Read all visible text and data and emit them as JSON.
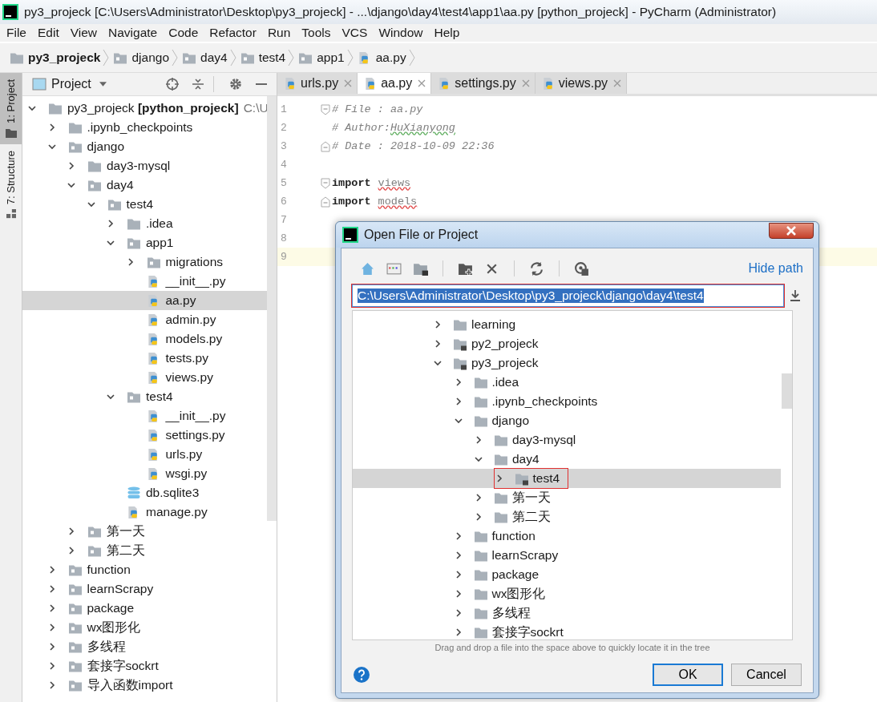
{
  "window": {
    "title": "py3_projeck [C:\\Users\\Administrator\\Desktop\\py3_projeck] - ...\\django\\day4\\test4\\app1\\aa.py [python_projeck] - PyCharm (Administrator)"
  },
  "menu": [
    "File",
    "Edit",
    "View",
    "Navigate",
    "Code",
    "Refactor",
    "Run",
    "Tools",
    "VCS",
    "Window",
    "Help"
  ],
  "breadcrumbs": [
    {
      "label": "py3_projeck",
      "kind": "root"
    },
    {
      "label": "django",
      "kind": "package"
    },
    {
      "label": "day4",
      "kind": "package"
    },
    {
      "label": "test4",
      "kind": "package"
    },
    {
      "label": "app1",
      "kind": "package"
    },
    {
      "label": "aa.py",
      "kind": "python"
    }
  ],
  "tool_strip": [
    {
      "label": "1: Project",
      "kind": "project",
      "selected": true
    },
    {
      "label": "7: Structure",
      "kind": "structure",
      "selected": false
    }
  ],
  "project_panel": {
    "title": "Project",
    "tree": [
      {
        "label": "py3_projeck **[python_projeck]**",
        "note": "C:\\U",
        "kind": "folder",
        "expanded": true,
        "selected": false,
        "children": [
          {
            "label": ".ipynb_checkpoints",
            "kind": "folder",
            "expanded": false,
            "selected": false
          },
          {
            "label": "django",
            "kind": "package",
            "expanded": true,
            "selected": false,
            "children": [
              {
                "label": "day3-mysql",
                "kind": "folder",
                "expanded": false,
                "selected": false
              },
              {
                "label": "day4",
                "kind": "package",
                "expanded": true,
                "selected": false,
                "children": [
                  {
                    "label": "test4",
                    "kind": "package",
                    "expanded": true,
                    "selected": false,
                    "children": [
                      {
                        "label": ".idea",
                        "kind": "folder",
                        "expanded": false,
                        "selected": false
                      },
                      {
                        "label": "app1",
                        "kind": "package",
                        "expanded": true,
                        "selected": false,
                        "children": [
                          {
                            "label": "migrations",
                            "kind": "package",
                            "expanded": false,
                            "selected": false
                          },
                          {
                            "label": "__init__.py",
                            "kind": "python",
                            "selected": false
                          },
                          {
                            "label": "aa.py",
                            "kind": "python",
                            "selected": true
                          },
                          {
                            "label": "admin.py",
                            "kind": "python",
                            "selected": false
                          },
                          {
                            "label": "models.py",
                            "kind": "python",
                            "selected": false
                          },
                          {
                            "label": "tests.py",
                            "kind": "python",
                            "selected": false
                          },
                          {
                            "label": "views.py",
                            "kind": "python",
                            "selected": false
                          }
                        ]
                      },
                      {
                        "label": "test4",
                        "kind": "package",
                        "expanded": true,
                        "selected": false,
                        "children": [
                          {
                            "label": "__init__.py",
                            "kind": "python",
                            "selected": false
                          },
                          {
                            "label": "settings.py",
                            "kind": "python",
                            "selected": false
                          },
                          {
                            "label": "urls.py",
                            "kind": "python",
                            "selected": false
                          },
                          {
                            "label": "wsgi.py",
                            "kind": "python",
                            "selected": false
                          }
                        ]
                      },
                      {
                        "label": "db.sqlite3",
                        "kind": "database",
                        "selected": false
                      },
                      {
                        "label": "manage.py",
                        "kind": "python",
                        "selected": false
                      }
                    ]
                  }
                ]
              },
              {
                "label": "第一天",
                "kind": "package",
                "expanded": false,
                "selected": false
              },
              {
                "label": "第二天",
                "kind": "package",
                "expanded": false,
                "selected": false
              }
            ]
          },
          {
            "label": "function",
            "kind": "package",
            "expanded": false,
            "selected": false
          },
          {
            "label": "learnScrapy",
            "kind": "package",
            "expanded": false,
            "selected": false
          },
          {
            "label": "package",
            "kind": "package",
            "expanded": false,
            "selected": false
          },
          {
            "label": "wx图形化",
            "kind": "package",
            "expanded": false,
            "selected": false
          },
          {
            "label": "多线程",
            "kind": "package",
            "expanded": false,
            "selected": false
          },
          {
            "label": "套接字sockrt",
            "kind": "package",
            "expanded": false,
            "selected": false
          },
          {
            "label": "导入函数import",
            "kind": "package",
            "expanded": false,
            "selected": false
          }
        ]
      }
    ]
  },
  "editor": {
    "tabs": [
      {
        "label": "urls.py",
        "selected": false
      },
      {
        "label": "aa.py",
        "selected": true
      },
      {
        "label": "settings.py",
        "selected": false
      },
      {
        "label": "views.py",
        "selected": false
      }
    ],
    "lines": [
      {
        "number": "1",
        "fold_open": true,
        "current": false,
        "tokens": [
          {
            "text": "# File  : aa.py",
            "kind": "comment"
          }
        ]
      },
      {
        "number": "2",
        "current": false,
        "tokens": [
          {
            "text": "# Author: ",
            "kind": "comment"
          },
          {
            "text": "HuXianyong",
            "kind": "typo"
          }
        ]
      },
      {
        "number": "3",
        "fold_close": true,
        "current": false,
        "tokens": [
          {
            "text": "# Date  : 2018-10-09 22:36",
            "kind": "comment"
          }
        ]
      },
      {
        "number": "4",
        "current": false
      },
      {
        "number": "5",
        "fold_open": true,
        "current": false,
        "tokens": [
          {
            "text": "import",
            "kind": "keyword"
          },
          {
            "text": "views",
            "kind": "unresolved"
          }
        ]
      },
      {
        "number": "6",
        "fold_close": true,
        "current": false,
        "tokens": [
          {
            "text": "import",
            "kind": "keyword"
          },
          {
            "text": "models",
            "kind": "unresolved"
          }
        ]
      },
      {
        "number": "7",
        "current": false
      },
      {
        "number": "8",
        "current": false
      },
      {
        "number": "9",
        "current": true
      }
    ]
  },
  "dialog": {
    "title": "Open File or Project",
    "hide_path": "Hide path",
    "path": {
      "value": "C:\\Users\\Administrator\\Desktop\\py3_projeck\\django\\day4\\test4",
      "highlighted": true
    },
    "tree": [
      {
        "label": "learning",
        "kind": "folder",
        "expanded": false,
        "selected": false,
        "highlighted": false
      },
      {
        "label": "py2_projeck",
        "kind": "project",
        "expanded": false,
        "selected": false,
        "highlighted": false
      },
      {
        "label": "py3_projeck",
        "kind": "project",
        "expanded": true,
        "selected": false,
        "highlighted": false,
        "children": [
          {
            "label": ".idea",
            "kind": "folder",
            "expanded": false,
            "selected": false,
            "highlighted": false
          },
          {
            "label": ".ipynb_checkpoints",
            "kind": "folder",
            "expanded": false,
            "selected": false,
            "highlighted": false
          },
          {
            "label": "django",
            "kind": "folder",
            "expanded": true,
            "selected": false,
            "highlighted": false,
            "children": [
              {
                "label": "day3-mysql",
                "kind": "folder",
                "expanded": false,
                "selected": false,
                "highlighted": false
              },
              {
                "label": "day4",
                "kind": "folder",
                "expanded": true,
                "selected": false,
                "highlighted": false,
                "children": [
                  {
                    "label": "test4",
                    "kind": "project",
                    "expanded": false,
                    "selected": true,
                    "highlighted": true
                  }
                ]
              },
              {
                "label": "第一天",
                "kind": "folder",
                "expanded": false,
                "selected": false,
                "highlighted": false
              },
              {
                "label": "第二天",
                "kind": "folder",
                "expanded": false,
                "selected": false,
                "highlighted": false
              }
            ]
          },
          {
            "label": "function",
            "kind": "folder",
            "expanded": false,
            "selected": false,
            "highlighted": false
          },
          {
            "label": "learnScrapy",
            "kind": "folder",
            "expanded": false,
            "selected": false,
            "highlighted": false
          },
          {
            "label": "package",
            "kind": "folder",
            "expanded": false,
            "selected": false,
            "highlighted": false
          },
          {
            "label": "wx图形化",
            "kind": "folder",
            "expanded": false,
            "selected": false,
            "highlighted": false
          },
          {
            "label": "多线程",
            "kind": "folder",
            "expanded": false,
            "selected": false,
            "highlighted": false
          },
          {
            "label": "套接字sockrt",
            "kind": "folder",
            "expanded": false,
            "selected": false,
            "highlighted": false
          }
        ]
      }
    ],
    "hint": "Drag and drop a file into the space above to quickly locate it in the tree",
    "buttons": [
      {
        "label": "OK",
        "kind": "default"
      },
      {
        "label": "Cancel",
        "kind": "normal"
      }
    ]
  }
}
